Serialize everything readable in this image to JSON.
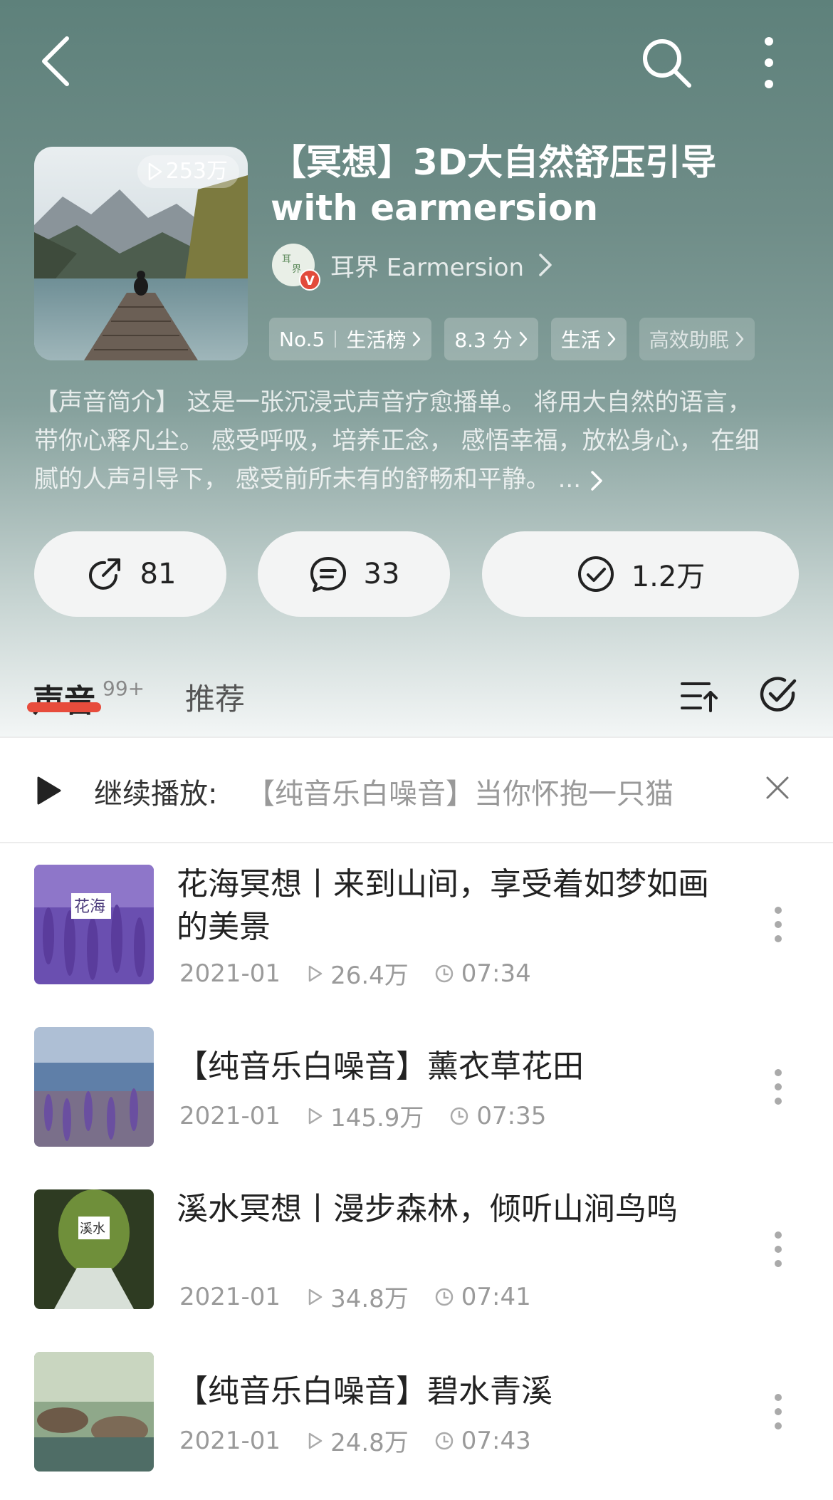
{
  "header": {
    "back_icon": "back-chevron-icon",
    "search_icon": "search-icon",
    "more_icon": "more-vertical-icon"
  },
  "album": {
    "play_count": "253万",
    "title": "【冥想】3D大自然舒压引导with earmersion",
    "author": "耳界 Earmersion",
    "tags": {
      "rank_no": "No.5",
      "rank_list": "生活榜",
      "score": "8.3 分",
      "category": "生活",
      "keyword": "高效助眠"
    },
    "intro": "【声音简介】 这是一张沉浸式声音疗愈播单。 将用大自然的语言， 带你心释凡尘。 感受呼吸，培养正念， 感悟幸福，放松身心， 在细腻的人声引导下， 感受前所未有的舒畅和平静。 ..."
  },
  "actions": {
    "share_count": "81",
    "comment_count": "33",
    "subscribe_count": "1.2万"
  },
  "tabs": {
    "sound_label": "声音",
    "sound_count": "99+",
    "recommend_label": "推荐"
  },
  "continue": {
    "label": "继续播放:",
    "title": "【纯音乐白噪音】当你怀抱一只猫"
  },
  "tracks": [
    {
      "title": "花海冥想丨来到山间，享受着如梦如画的美景",
      "date": "2021-01",
      "plays": "26.4万",
      "duration": "07:34",
      "thumb_text": "花海"
    },
    {
      "title": "【纯音乐白噪音】薰衣草花田",
      "date": "2021-01",
      "plays": "145.9万",
      "duration": "07:35",
      "thumb_text": ""
    },
    {
      "title": "溪水冥想丨漫步森林，倾听山涧鸟鸣",
      "date": "2021-01",
      "plays": "34.8万",
      "duration": "07:41",
      "thumb_text": "溪水"
    },
    {
      "title": "【纯音乐白噪音】碧水青溪",
      "date": "2021-01",
      "plays": "24.8万",
      "duration": "07:43",
      "thumb_text": ""
    }
  ],
  "colors": {
    "hero_top": "#5e817b",
    "accent_red": "#e74c3c",
    "muted_text": "#9a9a9a"
  }
}
